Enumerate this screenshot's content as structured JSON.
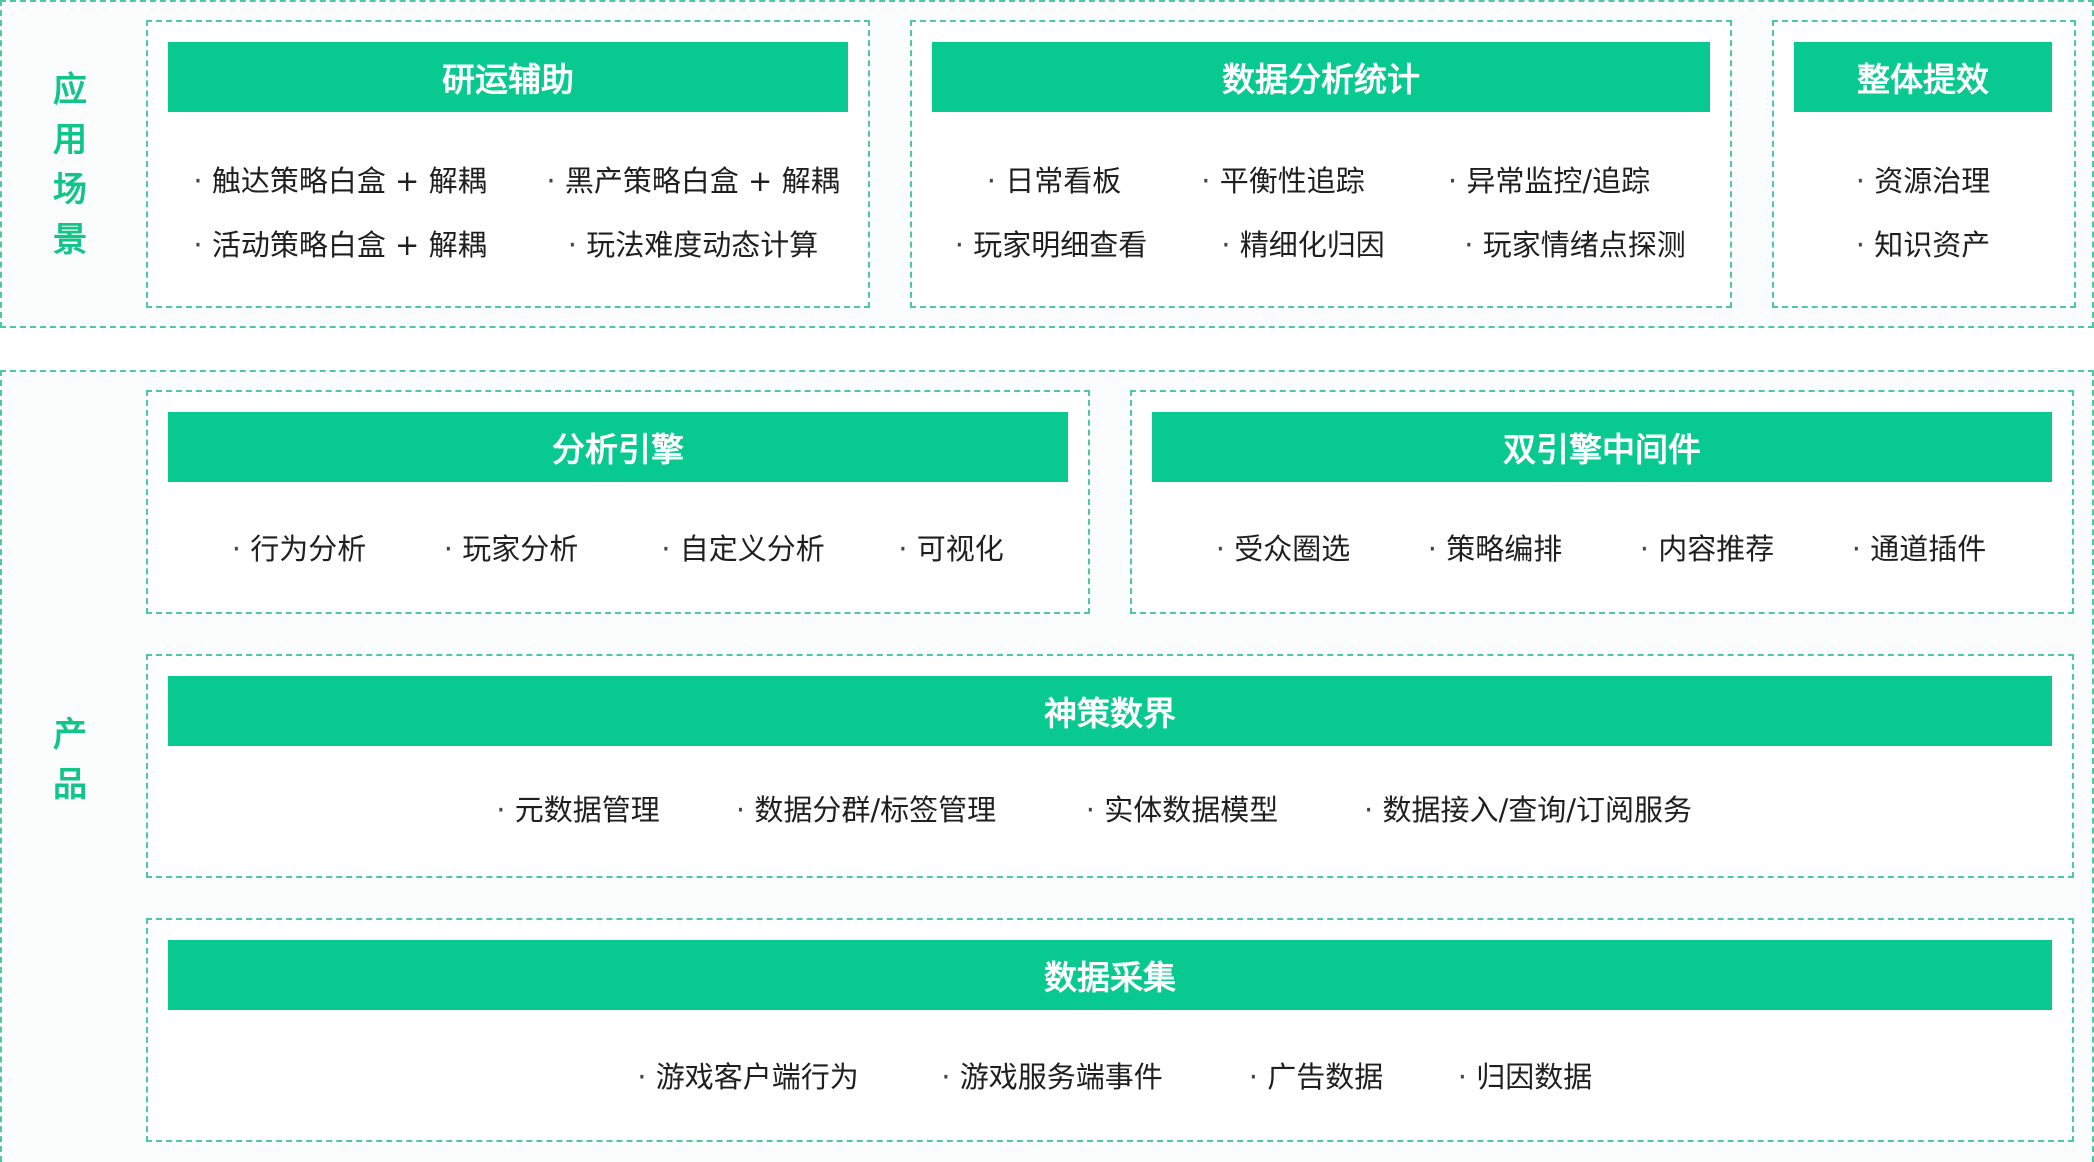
{
  "sections": {
    "apps_label": [
      "应",
      "用",
      "场",
      "景"
    ],
    "product_label": [
      "产",
      "品"
    ]
  },
  "panels": {
    "yanyun": {
      "title": "研运辅助",
      "items": [
        "触达策略白盒 + 解耦",
        "黑产策略白盒 + 解耦",
        "活动策略白盒 + 解耦",
        "玩法难度动态计算"
      ]
    },
    "shuju": {
      "title": "数据分析统计",
      "items": [
        "日常看板",
        "平衡性追踪",
        "异常监控/追踪",
        "玩家明细查看",
        "精细化归因",
        "玩家情绪点探测"
      ]
    },
    "zhengti": {
      "title": "整体提效",
      "items": [
        "资源治理",
        "知识资产"
      ]
    },
    "fenxi": {
      "title": "分析引擎",
      "items": [
        "行为分析",
        "玩家分析",
        "自定义分析",
        "可视化"
      ]
    },
    "shuangyinqing": {
      "title": "双引擎中间件",
      "items": [
        "受众圈选",
        "策略编排",
        "内容推荐",
        "通道插件"
      ]
    },
    "shence": {
      "title": "神策数界",
      "items": [
        "元数据管理",
        "数据分群/标签管理",
        "实体数据模型",
        "数据接入/查询/订阅服务"
      ]
    },
    "caiji": {
      "title": "数据采集",
      "items": [
        "游戏客户端行为",
        "游戏服务端事件",
        "广告数据",
        "归因数据"
      ]
    }
  },
  "colors": {
    "accent": "#08c98f",
    "border": "#4cc99d",
    "label": "#10c48a"
  }
}
